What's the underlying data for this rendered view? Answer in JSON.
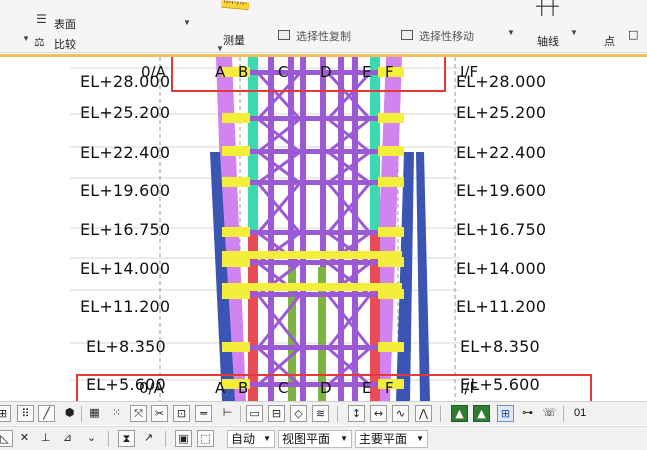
{
  "ribbon": {
    "surface_label": "表面",
    "compare_label": "比较",
    "measure_label": "测量",
    "copy_selection_label": "选择性复制",
    "move_selection_label": "选择性移动",
    "axis_label": "轴线",
    "point_label": "点"
  },
  "levels": {
    "left": [
      "EL+28.000",
      "EL+25.200",
      "EL+22.400",
      "EL+19.600",
      "EL+16.750",
      "EL+14.000",
      "EL+11.200",
      "EL+8.350",
      "EL+5.600"
    ],
    "right": [
      "EL+28.000",
      "EL+25.200",
      "EL+22.400",
      "EL+19.600",
      "EL+16.750",
      "EL+14.000",
      "EL+11.200",
      "EL+8.350",
      "EL+5.600"
    ]
  },
  "grid_labels": {
    "top": [
      "0/A",
      "A",
      "B",
      "C",
      "D",
      "E",
      "F",
      "I/F"
    ],
    "bottom": [
      "0/A",
      "A",
      "B",
      "C",
      "D",
      "E",
      "F",
      "I/F"
    ]
  },
  "toolbar": {
    "view_number": "01",
    "auto_select": "自动",
    "view_plane_select": "视图平面",
    "main_plane_select": "主要平面"
  },
  "colors": {
    "steel_magenta": "#cc77ee",
    "steel_violet": "#9b59d6",
    "column_blue": "#3a55b4",
    "column_cyan": "#3cd8b0",
    "column_red": "#e84d57",
    "column_green": "#7cb342",
    "beam_yellow": "#f3ee3a",
    "highlight_red": "#e53935"
  },
  "icons": [
    "surface-icon",
    "compare-icon",
    "measure-icon",
    "copy-selection-icon",
    "move-selection-icon",
    "axis-icon"
  ]
}
